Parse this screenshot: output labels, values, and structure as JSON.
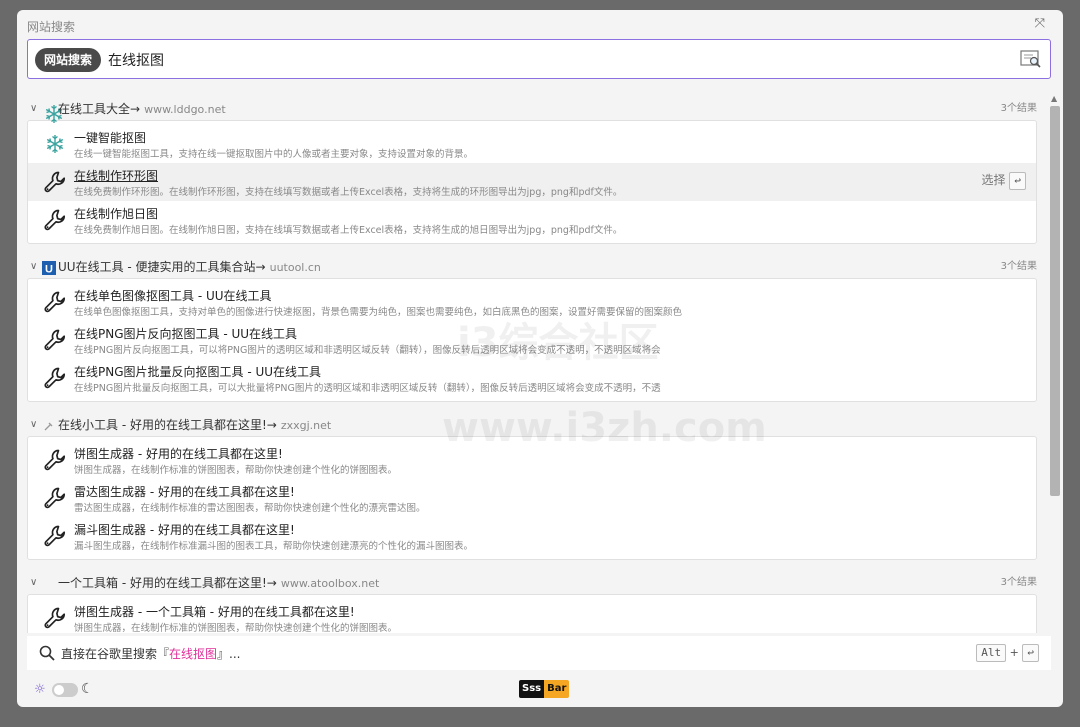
{
  "panel": {
    "title": "网站搜索",
    "collapse_icon": "collapse-icon"
  },
  "search": {
    "tag": "网站搜索",
    "value": "在线抠图",
    "placeholder": ""
  },
  "groups": [
    {
      "title": "在线工具大全",
      "url": "www.lddgo.net",
      "count": "3个结果",
      "icon": "snowflake-icon",
      "items": [
        {
          "title": "一键智能抠图",
          "desc": "在线一键智能抠图工具，支持在线一键抠取图片中的人像或者主要对象，支持设置对象的背景。",
          "icon": "snowflake-icon"
        },
        {
          "title": "在线制作环形图",
          "desc": "在线免费制作环形图。在线制作环形图，支持在线填写数据或者上传Excel表格，支持将生成的环形图导出为jpg，png和pdf文件。",
          "icon": "wrench-icon",
          "selected": true
        },
        {
          "title": "在线制作旭日图",
          "desc": "在线免费制作旭日图。在线制作旭日图，支持在线填写数据或者上传Excel表格，支持将生成的旭日图导出为jpg，png和pdf文件。",
          "icon": "wrench-icon"
        }
      ]
    },
    {
      "title": "UU在线工具 - 便捷实用的工具集合站",
      "url": "uutool.cn",
      "count": "3个结果",
      "icon": "uu-logo-icon",
      "items": [
        {
          "title": "在线单色图像抠图工具 - UU在线工具",
          "desc": "在线单色图像抠图工具，支持对单色的图像进行快速抠图，背景色需要为纯色，图案也需要纯色，如白底黑色的图案，设置好需要保留的图案颜色",
          "icon": "wrench-icon"
        },
        {
          "title": "在线PNG图片反向抠图工具 - UU在线工具",
          "desc": "在线PNG图片反向抠图工具，可以将PNG图片的透明区域和非透明区域反转（翻转），图像反转后透明区域将会变成不透明，不透明区域将会",
          "icon": "wrench-icon"
        },
        {
          "title": "在线PNG图片批量反向抠图工具 - UU在线工具",
          "desc": "在线PNG图片批量反向抠图工具，可以大批量将PNG图片的透明区域和非透明区域反转（翻转），图像反转后透明区域将会变成不透明，不透",
          "icon": "wrench-icon"
        }
      ]
    },
    {
      "title": "在线小工具 - 好用的在线工具都在这里!",
      "url": "zxxgj.net",
      "count": "",
      "icon": "small-tool-icon",
      "items": [
        {
          "title": "饼图生成器 - 好用的在线工具都在这里!",
          "desc": "饼图生成器，在线制作标准的饼图图表，帮助你快速创建个性化的饼图图表。",
          "icon": "wrench-icon"
        },
        {
          "title": "雷达图生成器 - 好用的在线工具都在这里!",
          "desc": "雷达图生成器，在线制作标准的雷达图图表，帮助你快速创建个性化的漂亮雷达图。",
          "icon": "wrench-icon"
        },
        {
          "title": "漏斗图生成器 - 好用的在线工具都在这里!",
          "desc": "漏斗图生成器，在线制作标准漏斗图的图表工具，帮助你快速创建漂亮的个性化的漏斗图图表。",
          "icon": "wrench-icon"
        }
      ]
    },
    {
      "title": "一个工具箱 - 好用的在线工具都在这里!",
      "url": "www.atoolbox.net",
      "count": "3个结果",
      "icon": "",
      "items": [
        {
          "title": "饼图生成器 - 一个工具箱 - 好用的在线工具都在这里!",
          "desc": "饼图生成器，在线制作标准的饼图图表，帮助你快速创建个性化的饼图图表。",
          "icon": "wrench-icon"
        }
      ]
    }
  ],
  "select_hint": {
    "label": "选择",
    "key": "↩"
  },
  "watermark": {
    "line1": "i3综合社区",
    "line2": "www.i3zh.com"
  },
  "google": {
    "prefix": "直接在谷歌里搜索『",
    "keyword": "在线抠图",
    "suffix": "』...",
    "key1": "Alt",
    "plus": "+",
    "key2": "↩"
  },
  "footer": {
    "logo_left": "Sss",
    "logo_right": "Bar"
  },
  "colors": {
    "accent": "#8c6fe0",
    "keyword": "#e0309a",
    "logo_orange": "#f5a623"
  }
}
